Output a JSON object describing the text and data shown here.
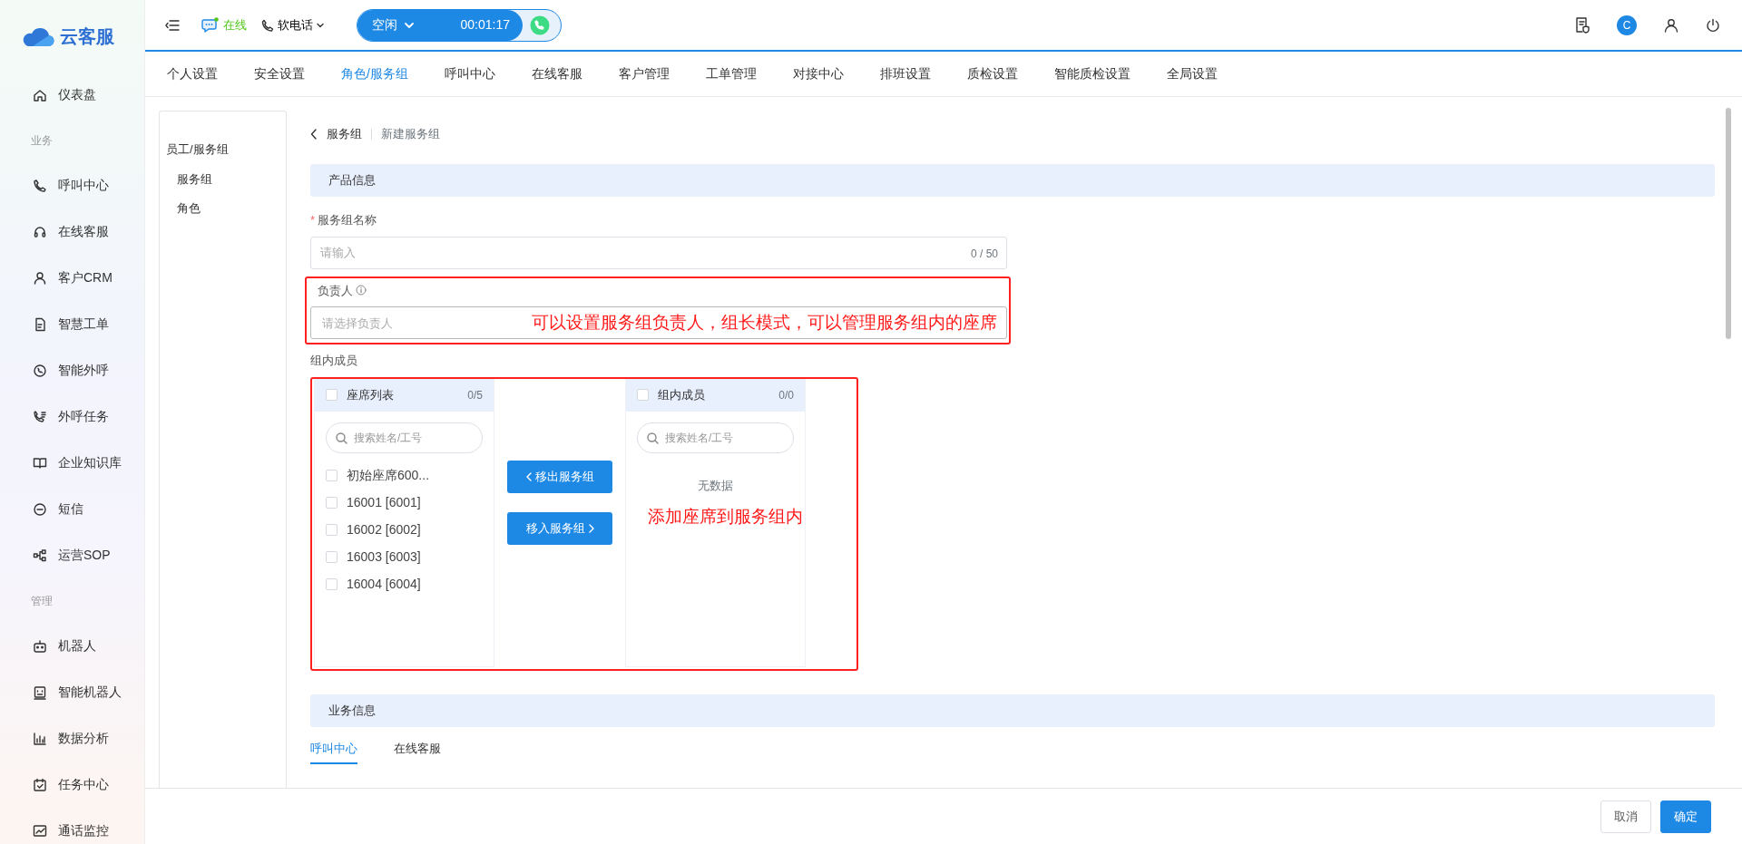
{
  "sidebar": {
    "logo": "云客服",
    "items": [
      {
        "kind": "item",
        "label": "仪表盘"
      },
      {
        "kind": "section",
        "label": "业务"
      },
      {
        "kind": "item",
        "label": "呼叫中心"
      },
      {
        "kind": "item",
        "label": "在线客服"
      },
      {
        "kind": "item",
        "label": "客户CRM"
      },
      {
        "kind": "item",
        "label": "智慧工单"
      },
      {
        "kind": "item",
        "label": "智能外呼"
      },
      {
        "kind": "item",
        "label": "外呼任务"
      },
      {
        "kind": "item",
        "label": "企业知识库"
      },
      {
        "kind": "item",
        "label": "短信"
      },
      {
        "kind": "item",
        "label": "运营SOP"
      },
      {
        "kind": "section",
        "label": "管理"
      },
      {
        "kind": "item",
        "label": "机器人"
      },
      {
        "kind": "item",
        "label": "智能机器人"
      },
      {
        "kind": "item",
        "label": "数据分析"
      },
      {
        "kind": "item",
        "label": "任务中心"
      },
      {
        "kind": "item",
        "label": "通话监控"
      }
    ]
  },
  "header": {
    "status": "在线",
    "phone_mode": "软电话",
    "call": {
      "state": "空闲",
      "timer": "00:01:17"
    },
    "avatar": "C"
  },
  "tabs": [
    {
      "label": "个人设置",
      "selected": false
    },
    {
      "label": "安全设置",
      "selected": false
    },
    {
      "label": "角色/服务组",
      "selected": true
    },
    {
      "label": "呼叫中心",
      "selected": false
    },
    {
      "label": "在线客服",
      "selected": false
    },
    {
      "label": "客户管理",
      "selected": false
    },
    {
      "label": "工单管理",
      "selected": false
    },
    {
      "label": "对接中心",
      "selected": false
    },
    {
      "label": "排班设置",
      "selected": false
    },
    {
      "label": "质检设置",
      "selected": false
    },
    {
      "label": "智能质检设置",
      "selected": false
    },
    {
      "label": "全局设置",
      "selected": false
    }
  ],
  "side_menu": [
    {
      "label": "员工/服务组",
      "children": [
        {
          "label": "服务组"
        },
        {
          "label": "角色"
        }
      ]
    }
  ],
  "breadcrumb": {
    "parent": "服务组",
    "current": "新建服务组"
  },
  "product_section": {
    "title": "产品信息",
    "name_field": {
      "required_mark": "*",
      "label": "服务组名称",
      "placeholder": "请输入",
      "counter": "0 / 50"
    },
    "owner_field": {
      "label": "负责人",
      "placeholder": "请选择负责人"
    },
    "members_label": "组内成员"
  },
  "transfer": {
    "left": {
      "title": "座席列表",
      "count": "0/5",
      "checked": false,
      "search_placeholder": "搜索姓名/工号",
      "items": [
        {
          "label": "初始座席600...",
          "checked": false
        },
        {
          "label": "16001 [6001]",
          "checked": false
        },
        {
          "label": "16002 [6002]",
          "checked": false
        },
        {
          "label": "16003 [6003]",
          "checked": false
        },
        {
          "label": "16004 [6004]",
          "checked": false
        }
      ]
    },
    "buttons": [
      {
        "label": "移出服务组",
        "kind": "back"
      },
      {
        "label": "移入服务组",
        "kind": "forward"
      }
    ],
    "right": {
      "title": "组内成员",
      "count": "0/0",
      "checked": false,
      "search_placeholder": "搜索姓名/工号",
      "empty_text": "无数据"
    }
  },
  "business_section": {
    "title": "业务信息",
    "tabs": [
      {
        "label": "呼叫中心",
        "selected": true
      },
      {
        "label": "在线客服",
        "selected": false
      }
    ]
  },
  "annotations": [
    {
      "text": "可以设置服务组负责人，组长模式，可以管理服务组内的座席"
    },
    {
      "text": "添加座席到服务组内"
    }
  ],
  "footer": {
    "buttons": [
      {
        "label": "取消",
        "kind": "secondary"
      },
      {
        "label": "确定",
        "kind": "primary"
      }
    ]
  }
}
